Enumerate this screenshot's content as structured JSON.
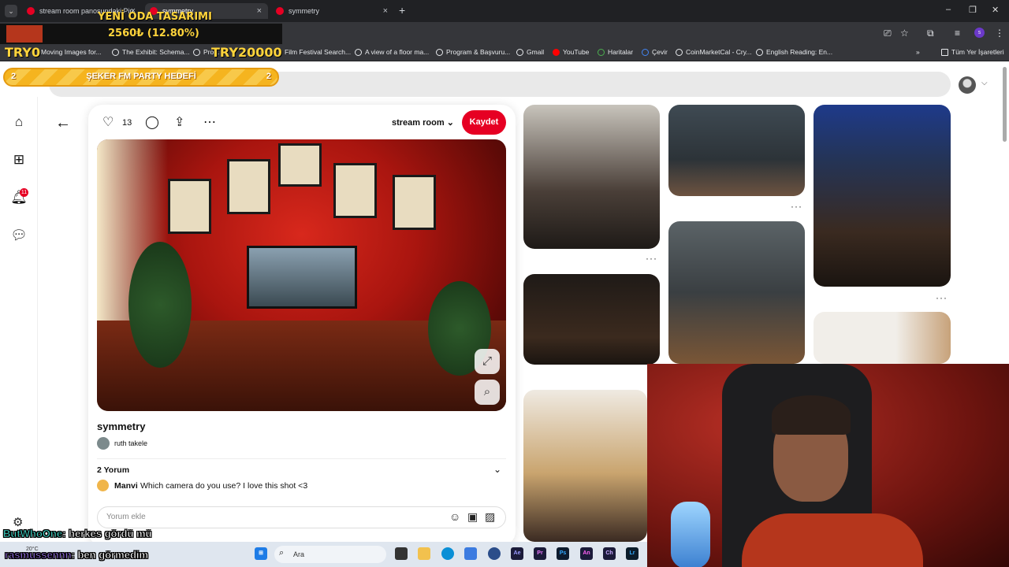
{
  "browser": {
    "tabs": [
      {
        "label": "stream room panosundaki Pin"
      },
      {
        "label": "symmetry"
      },
      {
        "label": "symmetry"
      }
    ],
    "new_tab": "+",
    "window_controls": [
      "–",
      "❐",
      "✕"
    ],
    "bookmarks": [
      {
        "label": "Moving Images for..."
      },
      {
        "label": "The Exhibit: Schema..."
      },
      {
        "label": "Pro..."
      },
      {
        "label": "Film Festival Search..."
      },
      {
        "label": "A view of a floor ma..."
      },
      {
        "label": "Program & Başvuru..."
      },
      {
        "label": "Gmail"
      },
      {
        "label": "YouTube"
      },
      {
        "label": "Haritalar"
      },
      {
        "label": "Çevir"
      },
      {
        "label": "CoinMarketCal - Cry..."
      },
      {
        "label": "English Reading: En..."
      },
      {
        "label": "Tüm Yer İşaretleri"
      }
    ],
    "bookmarks_more": "»"
  },
  "overlay": {
    "goal_title": "YENİ ODA TASARIMI",
    "goal_amount": "2560₺ (12.80%)",
    "try_left": "TRY0",
    "try_right": "TRY20000",
    "party_label": "ŞEKER FM PARTY HEDEFİ",
    "party_num_left": "2",
    "party_num_right": "2"
  },
  "pinterest": {
    "rail": {
      "notif_count": "11"
    },
    "pin": {
      "like_count": "13",
      "board": "stream room",
      "save_label": "Kaydet",
      "title": "symmetry",
      "author": "ruth takele",
      "comments_header": "2 Yorum",
      "comment": {
        "user": "Manvi",
        "text": "Which camera do you use? I love this shot <3"
      },
      "comment_placeholder": "Yorum ekle"
    },
    "feed_more": "···"
  },
  "taskbar": {
    "search_placeholder": "Ara",
    "weather": "20°C",
    "apps": [
      "Ae",
      "Pr",
      "Ps",
      "An",
      "Ch",
      "Lr"
    ]
  },
  "chat": [
    {
      "user": "ButWhoOne",
      "message": ": herkes gördü mü"
    },
    {
      "user": "rasmussennn",
      "message": ": ben görmedim"
    }
  ],
  "colors": {
    "pinterest_red": "#e60023",
    "goal_yellow": "#ffd43b"
  }
}
